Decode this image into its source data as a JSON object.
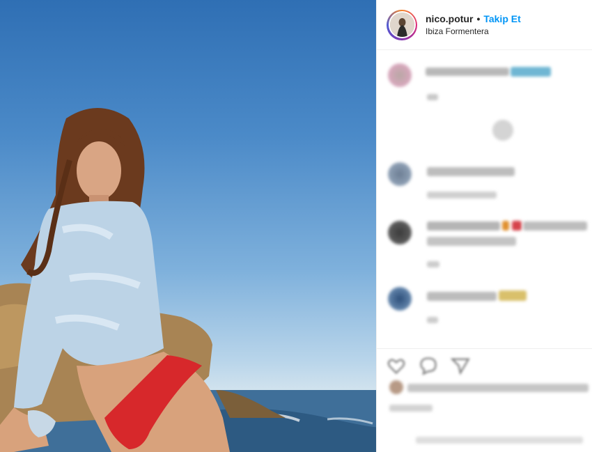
{
  "post": {
    "username": "nico.potur",
    "separator": "•",
    "follow_label": "Takip Et",
    "location": "Ibiza Formentera"
  },
  "icons": {
    "avatar": "profile-avatar",
    "like": "heart-icon",
    "comment": "comment-icon",
    "share": "share-icon"
  },
  "colors": {
    "follow_link": "#0095f6",
    "story_ring": "#dd2a7b",
    "sky": "#4b8ac8"
  }
}
